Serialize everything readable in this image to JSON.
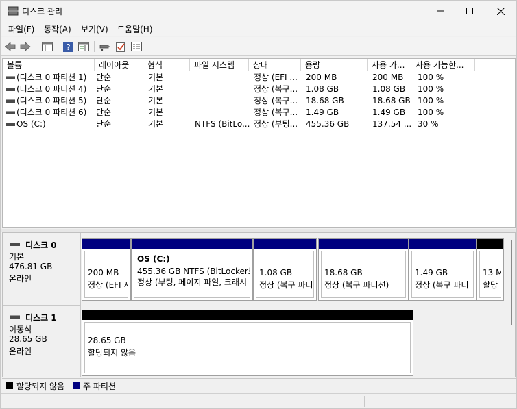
{
  "window": {
    "title": "디스크 관리"
  },
  "menu": [
    "파일(F)",
    "동작(A)",
    "보기(V)",
    "도움말(H)"
  ],
  "colors": {
    "primary_partition": "#000080",
    "unallocated": "#000000"
  },
  "volumes": {
    "columns": [
      "볼륨",
      "레이아웃",
      "형식",
      "파일 시스템",
      "상태",
      "용량",
      "사용 가...",
      "사용 가능한..."
    ],
    "rows": [
      {
        "name": "(디스크 0 파티션 1)",
        "layout": "단순",
        "type": "기본",
        "fs": "",
        "status": "정상 (EFI ...",
        "capacity": "200 MB",
        "free": "200 MB",
        "pct": "100 %"
      },
      {
        "name": "(디스크 0 파티션 4)",
        "layout": "단순",
        "type": "기본",
        "fs": "",
        "status": "정상 (복구...",
        "capacity": "1.08 GB",
        "free": "1.08 GB",
        "pct": "100 %"
      },
      {
        "name": "(디스크 0 파티션 5)",
        "layout": "단순",
        "type": "기본",
        "fs": "",
        "status": "정상 (복구...",
        "capacity": "18.68 GB",
        "free": "18.68 GB",
        "pct": "100 %"
      },
      {
        "name": "(디스크 0 파티션 6)",
        "layout": "단순",
        "type": "기본",
        "fs": "",
        "status": "정상 (복구...",
        "capacity": "1.49 GB",
        "free": "1.49 GB",
        "pct": "100 %"
      },
      {
        "name": "OS (C:)",
        "layout": "단순",
        "type": "기본",
        "fs": "NTFS (BitLo...",
        "status": "정상 (부팅...",
        "capacity": "455.36 GB",
        "free": "137.54 ...",
        "pct": "30 %"
      }
    ]
  },
  "disk0": {
    "name": "디스크 0",
    "type": "기본",
    "size": "476.81 GB",
    "state": "온라인",
    "partitions": [
      {
        "title": "",
        "size": "200 MB",
        "status": "정상 (EFI 시"
      },
      {
        "title": "OS  (C:)",
        "size": "455.36 GB NTFS (BitLocker로",
        "status": "정상 (부팅, 페이지 파일, 크래시"
      },
      {
        "title": "",
        "size": "1.08 GB",
        "status": "정상 (복구 파티"
      },
      {
        "title": "",
        "size": "18.68 GB",
        "status": "정상 (복구 파티션)"
      },
      {
        "title": "",
        "size": "1.49 GB",
        "status": "정상 (복구 파티"
      },
      {
        "title": "",
        "size": "13 M",
        "status": "할당"
      }
    ]
  },
  "disk1": {
    "name": "디스크 1",
    "type": "이동식",
    "size": "28.65 GB",
    "state": "온라인",
    "partitions": [
      {
        "size": "28.65 GB",
        "status": "할당되지 않음"
      }
    ]
  },
  "legend": {
    "unallocated": "할당되지 않음",
    "primary": "주 파티션"
  }
}
